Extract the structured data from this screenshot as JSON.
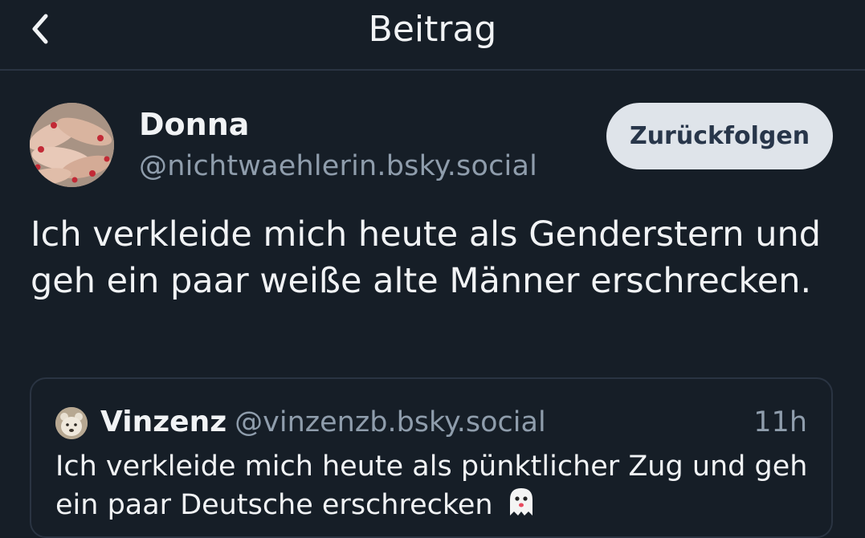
{
  "header": {
    "back_icon": "chevron-left-icon",
    "title": "Beitrag"
  },
  "post": {
    "author": {
      "display_name": "Donna",
      "handle": "@nichtwaehlerin.bsky.social",
      "avatar_icon": "avatar-hands-photo"
    },
    "follow_button_label": "Zurückfolgen",
    "text": "Ich verkleide mich heute als Genderstern und geh ein paar weiße alte Männer erschrecken."
  },
  "quote": {
    "author": {
      "display_name": "Vinzenz",
      "handle": "@vinzenzb.bsky.social",
      "avatar_icon": "avatar-bear-photo"
    },
    "time": "11h",
    "text": "Ich verkleide mich heute als pünktlicher Zug und geh ein paar Deutsche erschrecken",
    "emoji_icon": "ghost-icon"
  },
  "colors": {
    "background": "#161e27",
    "divider": "#2a3442",
    "text_primary": "#f1f3f5",
    "text_secondary": "#8f9dac",
    "button_bg": "#dfe4ea",
    "button_text": "#28364a"
  }
}
